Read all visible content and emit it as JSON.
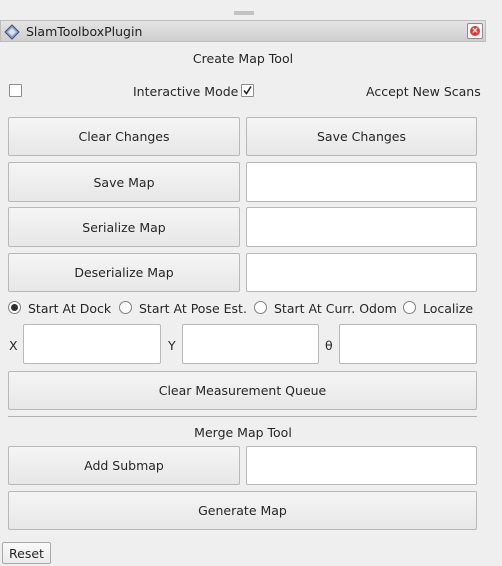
{
  "window": {
    "title": "SlamToolboxPlugin"
  },
  "create_map": {
    "section_title": "Create Map Tool",
    "interactive_mode_label": "Interactive Mode",
    "interactive_mode_checked": true,
    "accept_scans_label": "Accept New Scans",
    "accept_scans_checked": false,
    "clear_changes_label": "Clear Changes",
    "save_changes_label": "Save Changes",
    "save_map_label": "Save Map",
    "save_map_value": "",
    "serialize_map_label": "Serialize Map",
    "serialize_map_value": "",
    "deserialize_map_label": "Deserialize Map",
    "deserialize_map_value": ""
  },
  "start_options": {
    "selected": "Start At Dock",
    "items": [
      {
        "label": "Start At Dock"
      },
      {
        "label": "Start At Pose Est."
      },
      {
        "label": "Start At Curr. Odom"
      },
      {
        "label": "Localize"
      }
    ]
  },
  "pose": {
    "x_label": "X",
    "x_value": "",
    "y_label": "Y",
    "y_value": "",
    "theta_label": "θ",
    "theta_value": ""
  },
  "clear_queue_label": "Clear Measurement Queue",
  "merge_map": {
    "section_title": "Merge Map Tool",
    "add_submap_label": "Add Submap",
    "submap_value": "",
    "generate_map_label": "Generate Map"
  },
  "reset_label": "Reset",
  "colors": {
    "background": "#efefef",
    "close_icon": "#d93c3c",
    "title_bar": "#d8d8d8"
  }
}
